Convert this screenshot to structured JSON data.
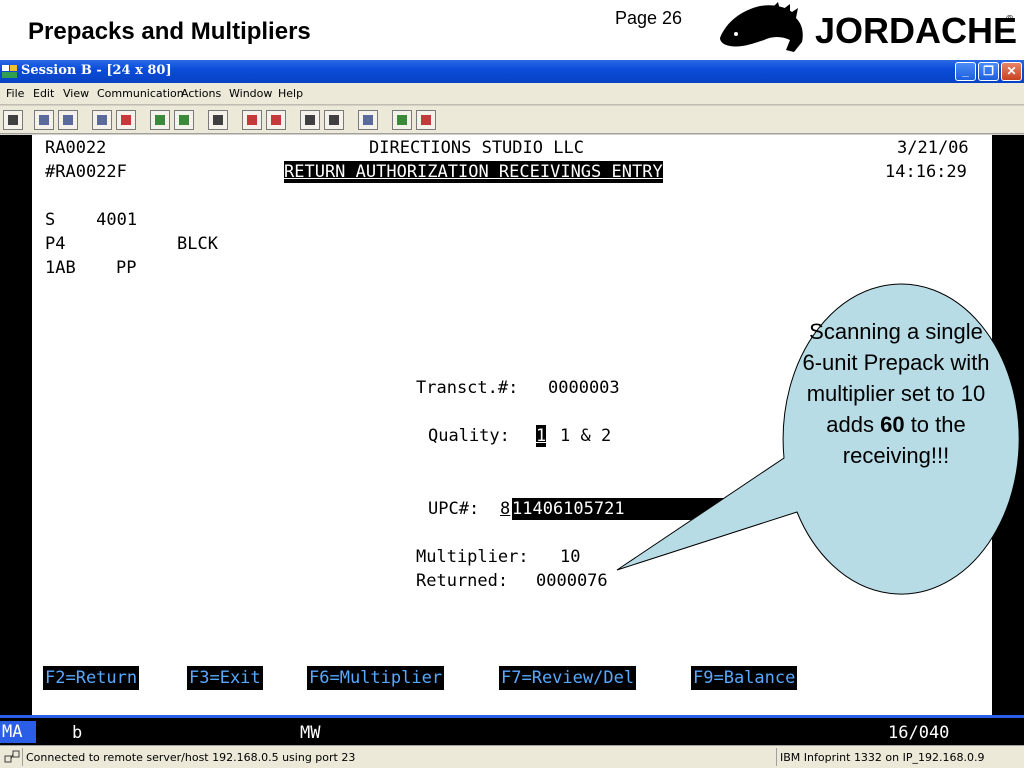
{
  "slide": {
    "title": "Prepacks and Multipliers",
    "page": "Page 26",
    "brand": "JORDACHE",
    "brand_mark": "®"
  },
  "window": {
    "title": "Session B - [24 x 80]",
    "menu": [
      "File",
      "Edit",
      "View",
      "Communication",
      "Actions",
      "Window",
      "Help"
    ],
    "buttons": {
      "minimize": "_",
      "restore": "❐",
      "close": "✕"
    }
  },
  "terminal": {
    "program": "RA0022",
    "company": "DIRECTIONS STUDIO LLC",
    "date": "3/21/06",
    "screen_id": "#RA0022F",
    "screen_title": "RETURN AUTHORIZATION RECEIVINGS ENTRY",
    "time": "14:16:29",
    "line1": "S    4001",
    "line2_a": "P4",
    "line2_b": "BLCK",
    "line3_a": "1AB",
    "line3_b": "PP",
    "transct_label": "Transct.#:",
    "transct_value": "0000003",
    "quality_label": "Quality:",
    "quality_value": "1",
    "quality_options": "1 & 2",
    "upc_label": "UPC#:",
    "upc_first": "8",
    "upc_rest": "11406105721",
    "multiplier_label": "Multiplier:",
    "multiplier_value": "10",
    "returned_label": "Returned:",
    "returned_value": "0000076",
    "fkeys": [
      "F2=Return",
      "F3=Exit",
      "F6=Multiplier",
      "F7=Review/Del",
      "F9=Balance"
    ]
  },
  "oia": {
    "mode": "MA",
    "session": "b",
    "mw": "MW",
    "cursor": "16/040"
  },
  "status": {
    "connection": "Connected to remote server/host 192.168.0.5 using port 23",
    "printer": "IBM Infoprint 1332 on IP_192.168.0.9"
  },
  "callout": {
    "text_before": "Scanning a single 6-unit Prepack with multiplier set to 10 adds ",
    "text_bold": "60",
    "text_after": " to the receiving!!!",
    "fill": "#b7dce6"
  }
}
